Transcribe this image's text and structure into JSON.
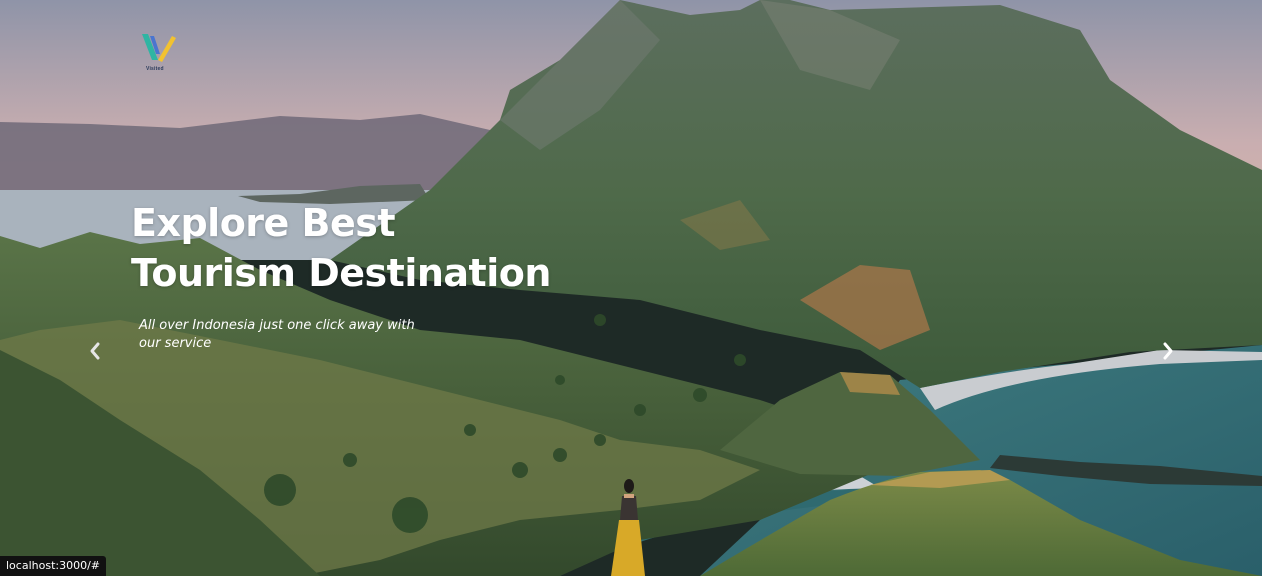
{
  "brand": {
    "name": "Visited",
    "logo_icon": "v-letter-logo-icon"
  },
  "hero": {
    "headline_line1": "Explore Best",
    "headline_line2": "Tourism Destination",
    "subtitle": "All over Indonesia just one click away with our service",
    "background_image": "landscape-island-hills-icon"
  },
  "carousel": {
    "prev_icon": "chevron-left-icon",
    "next_icon": "chevron-right-icon"
  },
  "status_bar": {
    "url": "localhost:3000/#"
  },
  "colors": {
    "headline_text": "#ffffff",
    "status_bar_bg": "#111111",
    "logo_teal": "#2fb5a3",
    "logo_yellow": "#f2c230",
    "logo_blue": "#3b6fd6"
  }
}
